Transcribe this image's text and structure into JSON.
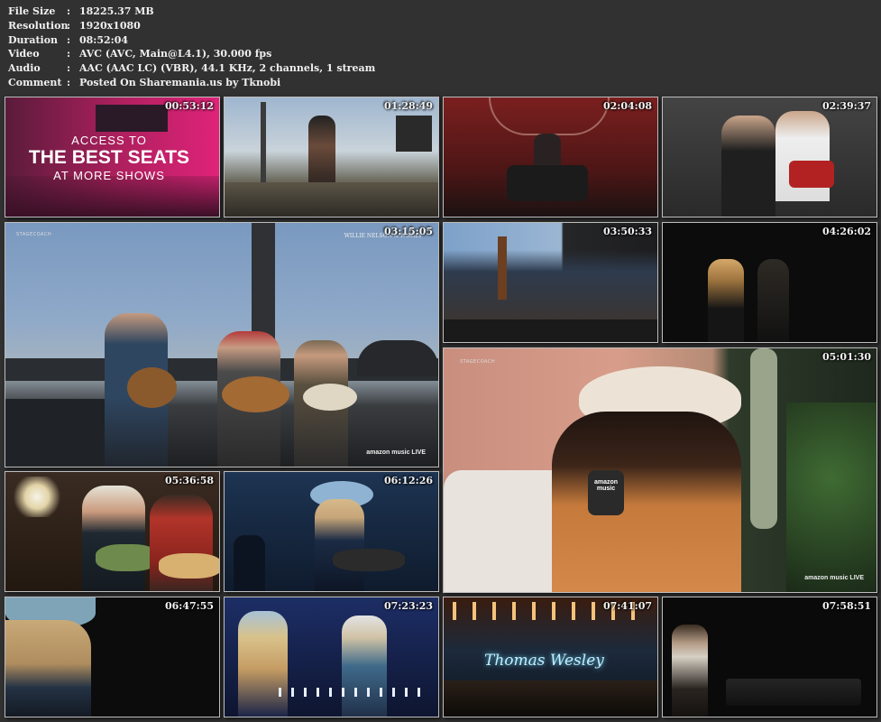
{
  "info": {
    "rows": [
      {
        "key": "File Size",
        "value": "18225.37 MB"
      },
      {
        "key": "Resolution",
        "value": "1920x1080"
      },
      {
        "key": "Duration",
        "value": "08:52:04"
      },
      {
        "key": "Video",
        "value": "AVC (AVC, Main@L4.1), 30.000 fps"
      },
      {
        "key": "Audio",
        "value": "AAC (AAC LC) (VBR), 44.1 KHz, 2 channels, 1 stream"
      },
      {
        "key": "Comment",
        "value": "Posted On Sharemania.us by Tknobi"
      }
    ],
    "separator": ":"
  },
  "thumbs": {
    "t1": {
      "time": "00:53:12",
      "line1": "ACCESS TO",
      "line2": "THE BEST SEATS",
      "line3": "AT MORE SHOWS"
    },
    "t2": {
      "time": "01:28:49"
    },
    "t3": {
      "time": "02:04:08"
    },
    "t4": {
      "time": "02:39:37"
    },
    "t5": {
      "time": "03:15:05",
      "brand": "STAGECOACH",
      "caption": "WILLIE NELSON & FAMILY",
      "amz": "amazon music LIVE"
    },
    "t6": {
      "time": "03:50:33"
    },
    "t7": {
      "time": "04:26:02"
    },
    "t8": {
      "time": "05:01:30",
      "brand": "STAGECOACH",
      "amz": "amazon music LIVE",
      "mic": "amazon music"
    },
    "t9": {
      "time": "05:36:58"
    },
    "t10": {
      "time": "06:12:26"
    },
    "t11": {
      "time": "06:47:55"
    },
    "t12": {
      "time": "07:23:23"
    },
    "t13": {
      "time": "07:41:07",
      "sign": "Thomas Wesley"
    },
    "t14": {
      "time": "07:58:51"
    }
  },
  "colors": {
    "background": "#313131",
    "promo_magenta": "#c2186e",
    "sky_blue": "#7e9cbf"
  }
}
